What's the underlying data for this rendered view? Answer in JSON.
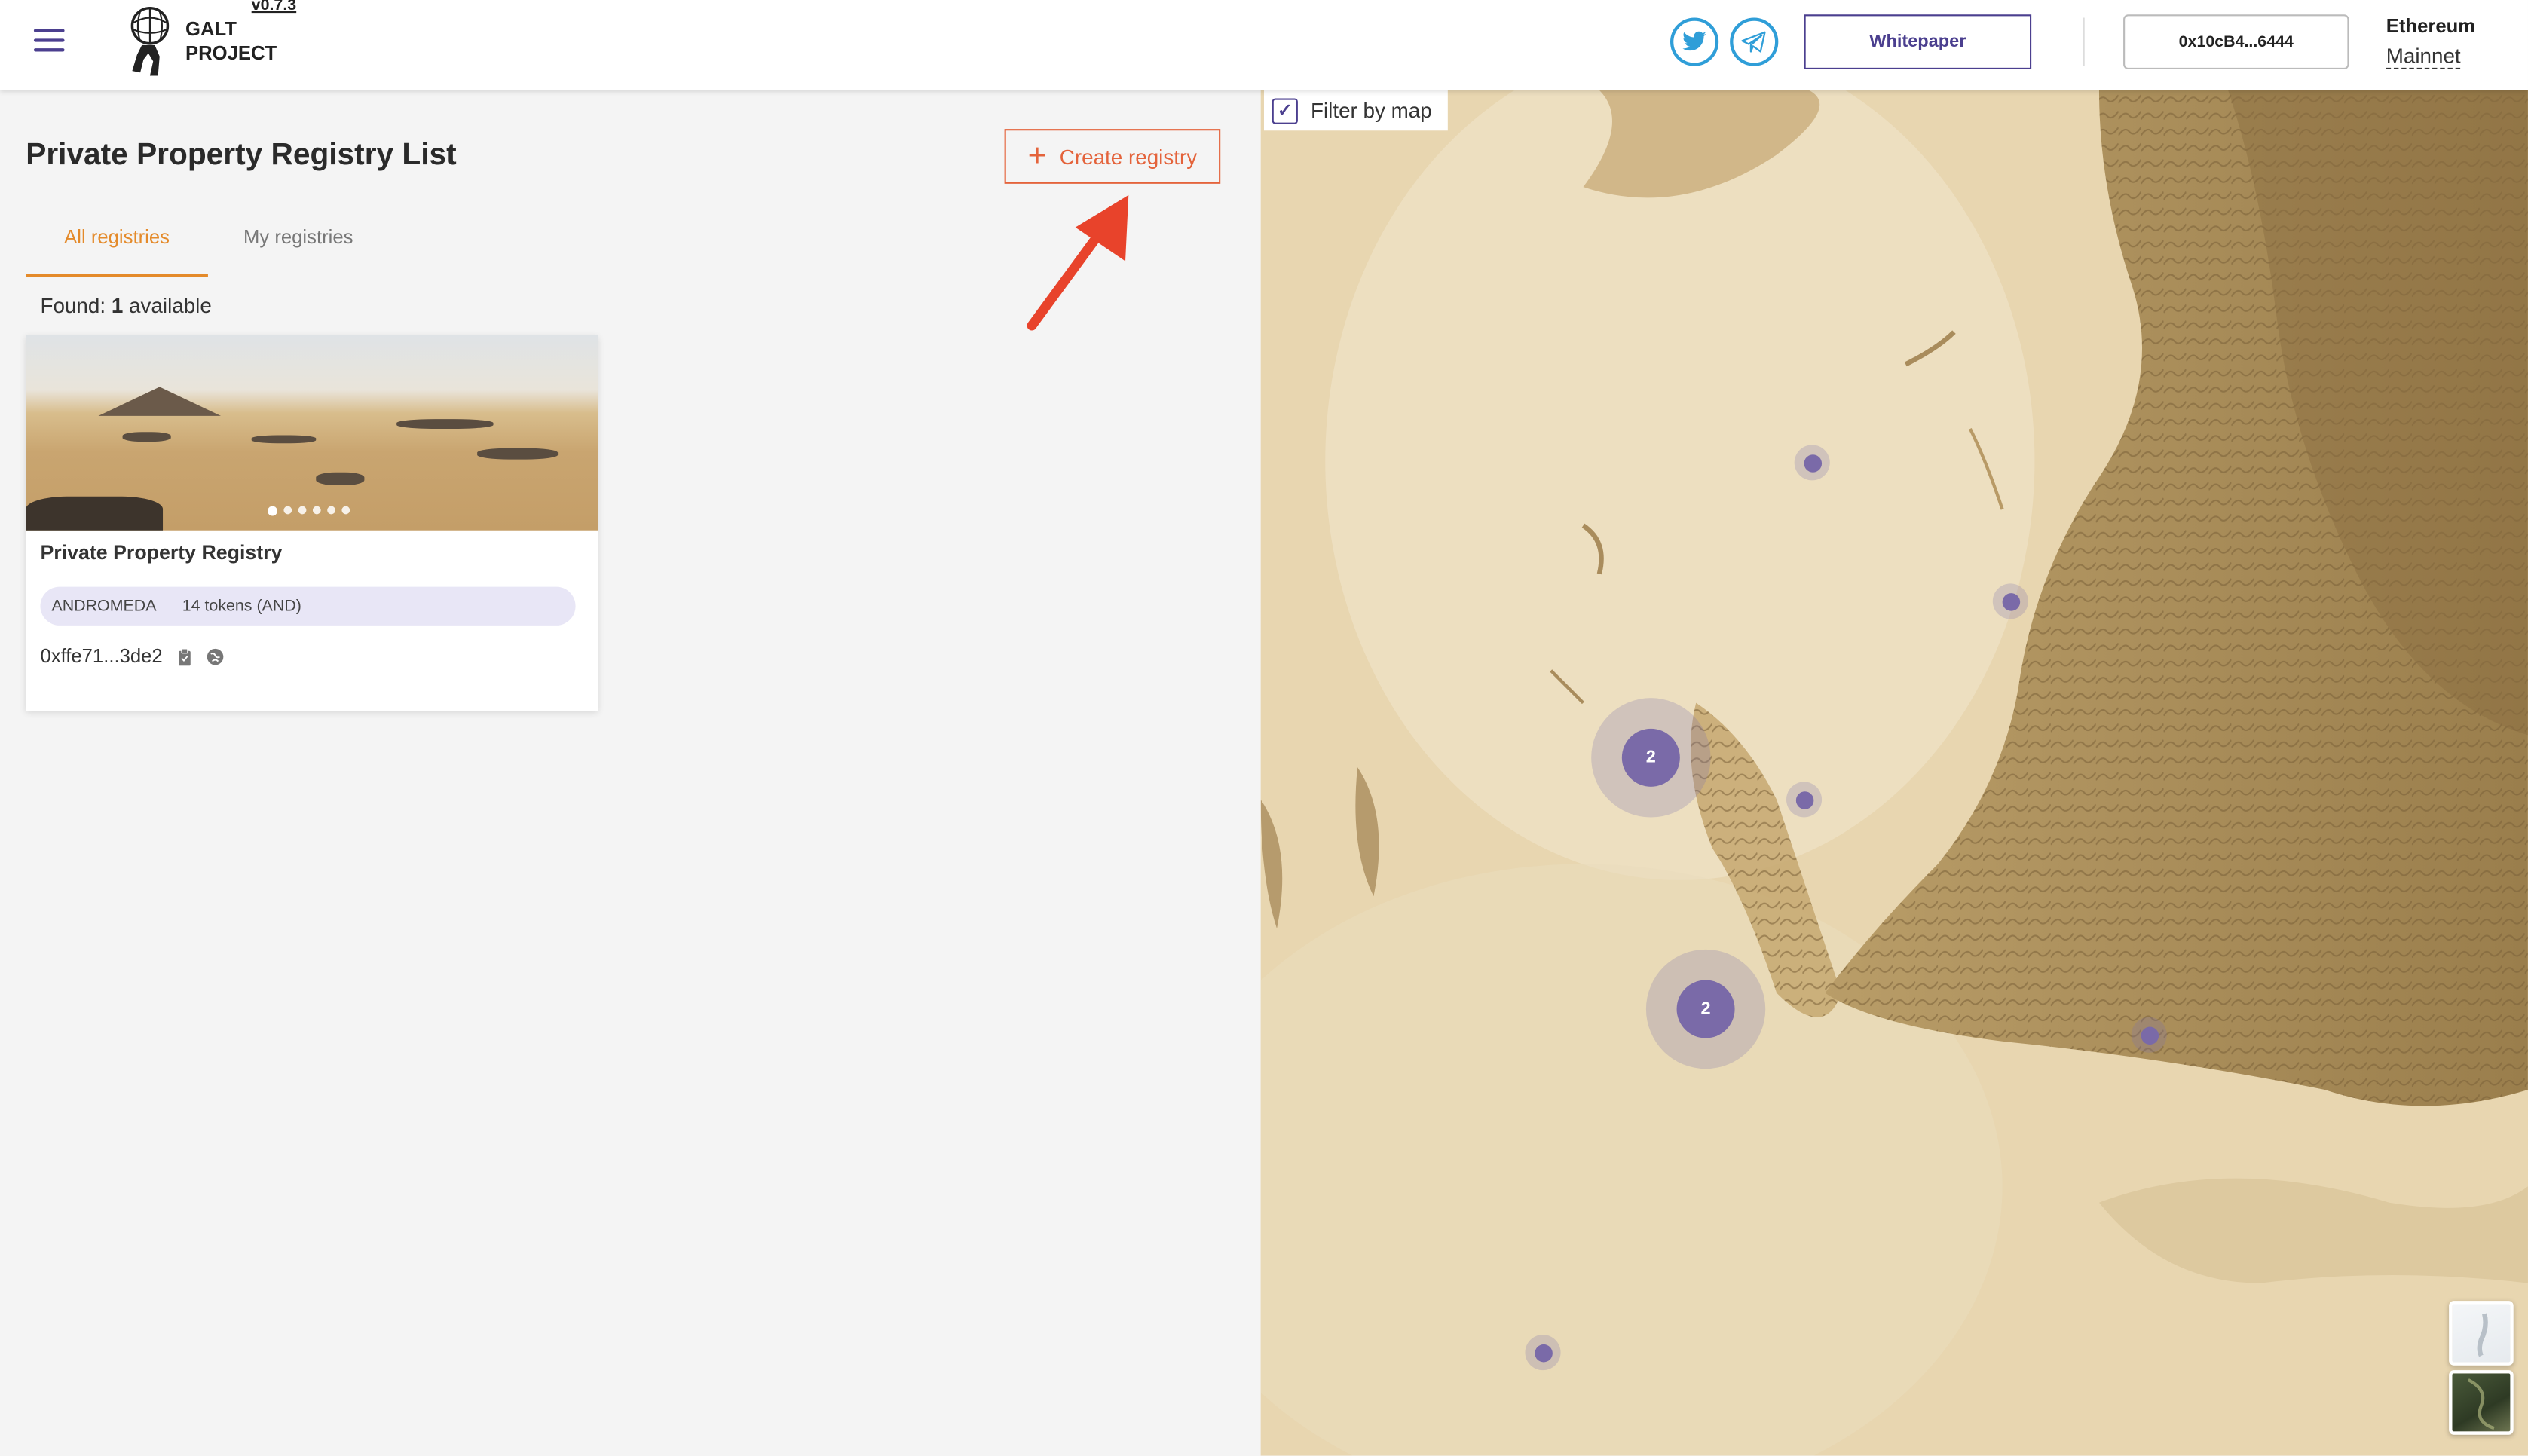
{
  "header": {
    "version": "v0.7.3",
    "logo_line1": "GALT",
    "logo_line2": "PROJECT",
    "whitepaper_label": "Whitepaper",
    "wallet_address": "0x10cB4...6444",
    "network_label": "Ethereum",
    "network_value": "Mainnet",
    "social": [
      "twitter-icon",
      "telegram-icon"
    ]
  },
  "main": {
    "title": "Private Property Registry List",
    "create_label": "Create registry",
    "tabs": [
      {
        "label": "All registries",
        "active": true
      },
      {
        "label": "My registries",
        "active": false
      }
    ],
    "found_prefix": "Found:",
    "found_count": "1",
    "found_suffix": "available"
  },
  "card": {
    "title": "Private Property Registry",
    "token_symbol": "ANDROMEDA",
    "token_count": "14 tokens (AND)",
    "address": "0xffe71...3de2",
    "image_slides": 6
  },
  "map": {
    "filter_label": "Filter by map",
    "filter_checked": true,
    "clusters": [
      {
        "count": "2"
      },
      {
        "count": "2"
      }
    ],
    "markers": 6
  },
  "colors": {
    "accent_purple": "#4b3f8f",
    "accent_orange": "#e4633b",
    "tab_active": "#e48a2a",
    "cluster": "#7a6aa8"
  }
}
